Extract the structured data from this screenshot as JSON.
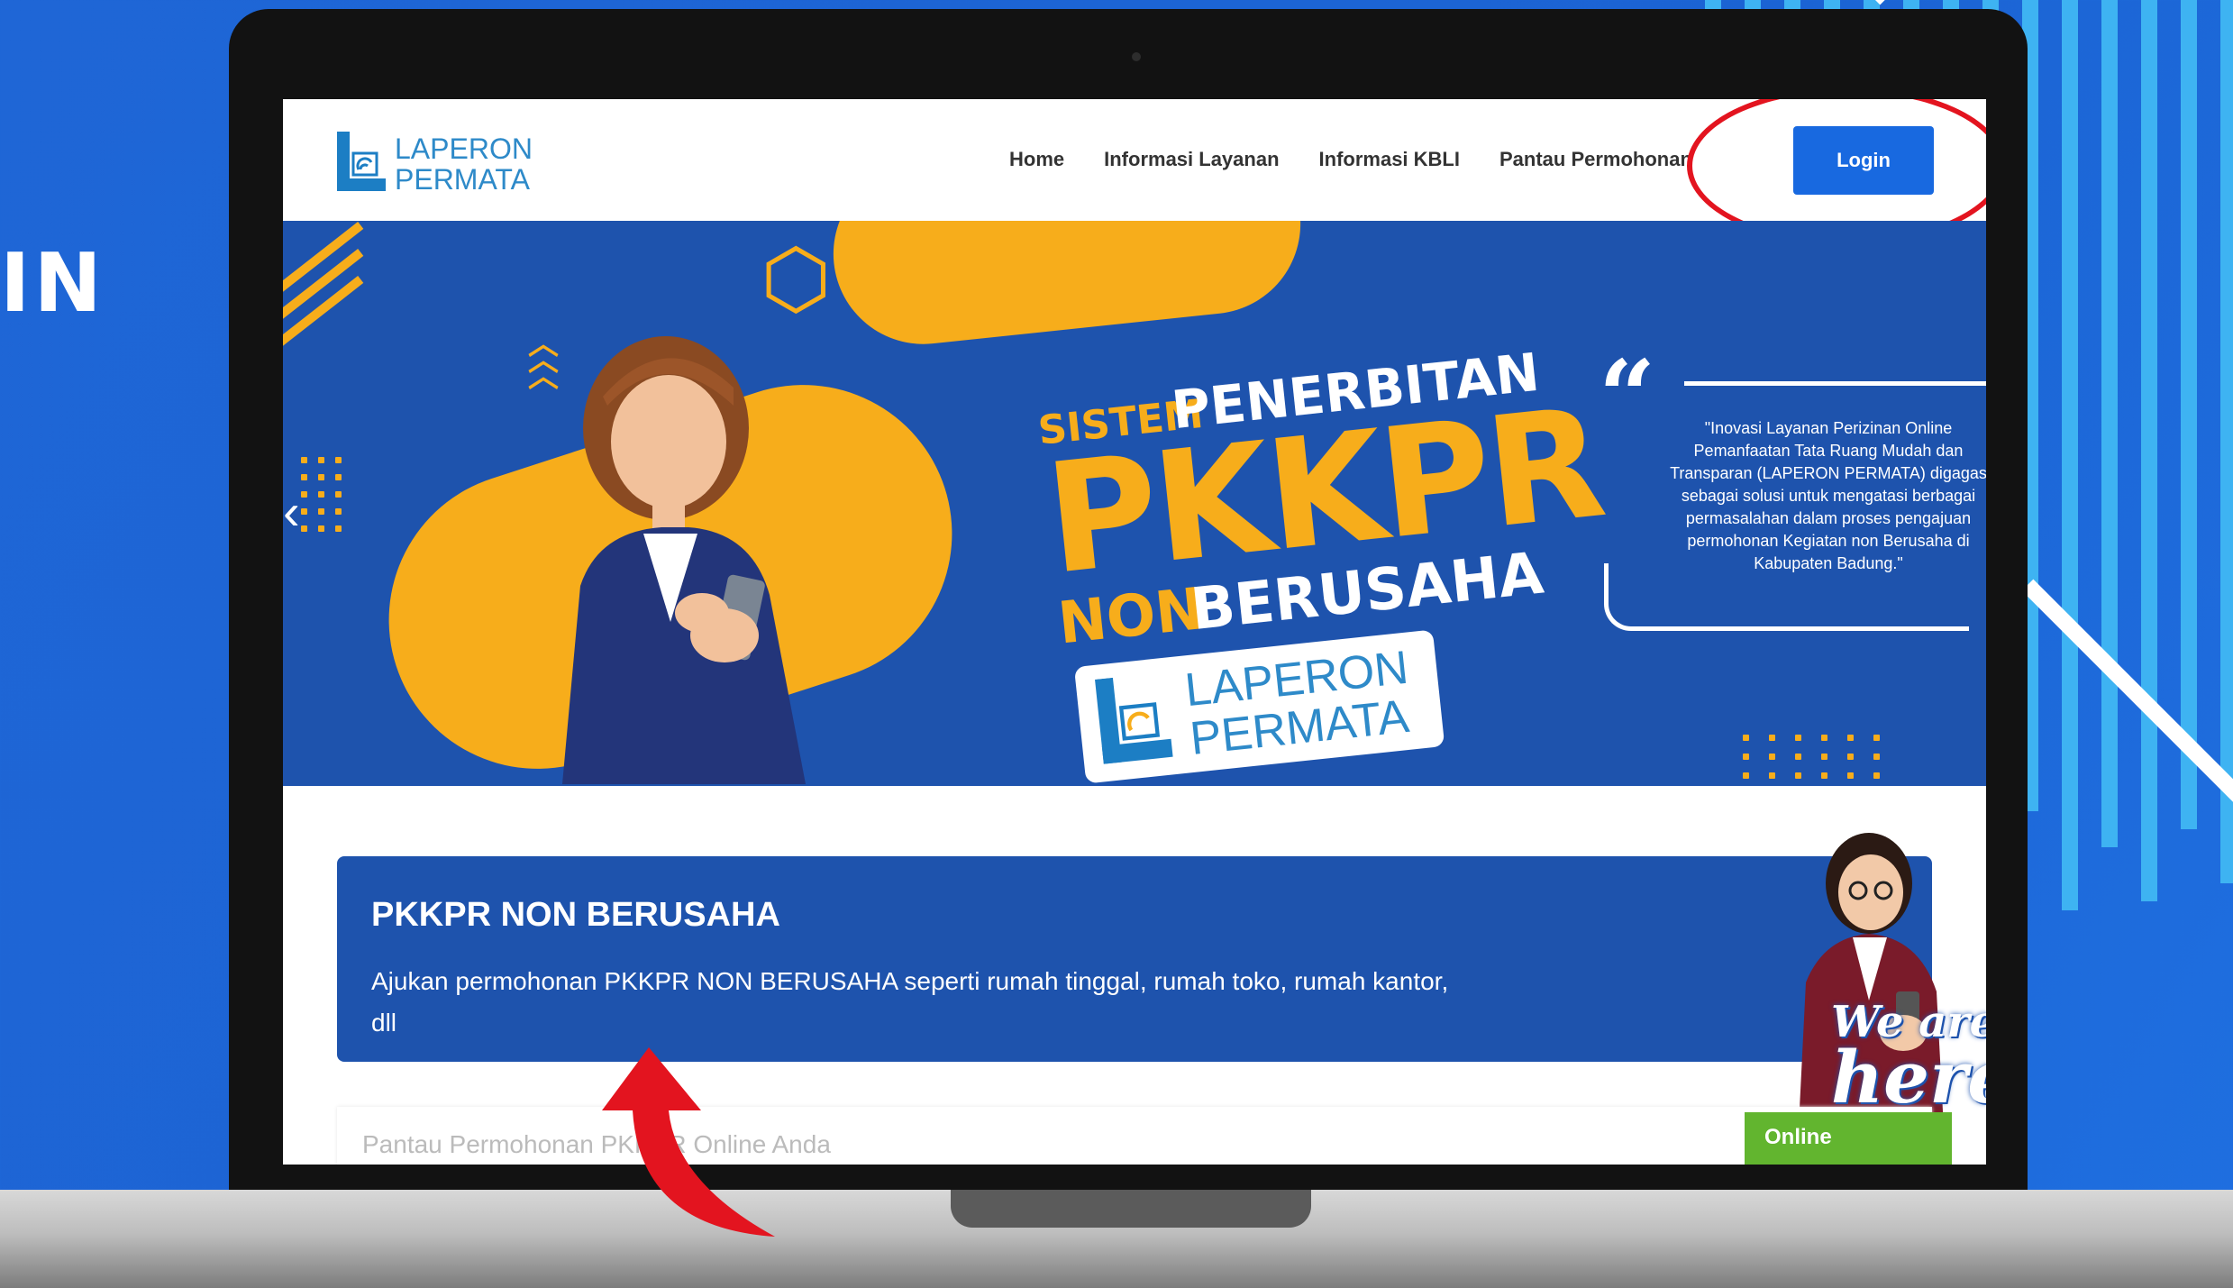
{
  "background": {
    "side_text": "IN",
    "accent": "#1f66d6",
    "stripe_color": "#3eb3f2"
  },
  "navbar": {
    "logo_line1": "LAPERON",
    "logo_line2": "PERMATA",
    "links": [
      "Home",
      "Informasi Layanan",
      "Informasi KBLI",
      "Pantau Permohonan"
    ],
    "login_label": "Login",
    "highlight_color": "#e3141f"
  },
  "hero": {
    "title_sistem": "SISTEM",
    "title_penerbitan": "PENERBITAN",
    "title_pkkpr": "PKKPR",
    "title_non": "NON",
    "title_berusaha": "BERUSAHA",
    "badge_line1": "LAPERON",
    "badge_line2": "PERMATA",
    "quote": "\"Inovasi Layanan Perizinan Online Pemanfaatan Tata Ruang Mudah dan Transparan (LAPERON PERMATA) digagas sebagai solusi untuk mengatasi berbagai permasalahan dalam proses pengajuan permohonan Kegiatan non Berusaha di Kabupaten Badung.\"",
    "colors": {
      "blue": "#1e53ad",
      "yellow": "#f7ad1b"
    }
  },
  "service_card": {
    "title": "PKKPR NON BERUSAHA",
    "description": "Ajukan permohonan PKKPR NON BERUSAHA seperti rumah tinggal, rumah toko, rumah kantor, dll"
  },
  "assistant": {
    "line1": "We are",
    "line2": "here"
  },
  "tracking": {
    "placeholder": "Pantau Permohonan PKKPR Online Anda",
    "online_label": "Online",
    "online_color": "#62b52f"
  }
}
